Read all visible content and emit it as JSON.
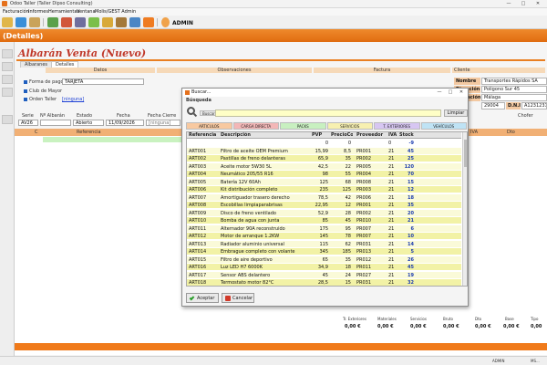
{
  "window": {
    "title": "Odoo Taller (Taller Dipso Consulting)",
    "controls": [
      "—",
      "□",
      "✕"
    ]
  },
  "menu": [
    "Facturación",
    "Informes",
    "Herramientas",
    "Ventana",
    "Molis/GEST Admin"
  ],
  "toolbar": {
    "user": "ADMIN"
  },
  "header": {
    "title": "(Detalles)"
  },
  "document": {
    "title": "Albarán Venta (Nuevo)",
    "tabs": [
      "Albaranes",
      "Detalles"
    ],
    "sections": [
      "Datos",
      "Observaciones",
      "Factura",
      "Cliente"
    ],
    "fields": {
      "forma_pago_label": "Forma de pago",
      "forma_pago_value": "TARJETA",
      "club_label": "Club de Mayor",
      "orden_label": "Orden Taller",
      "orden_link": "[ninguna]"
    },
    "cliente": {
      "nombre_label": "Nombre",
      "nombre_value": "Transportes Rápidos SA",
      "direccion_label": "Dirección",
      "direccion_value": "Polígono Sur 45",
      "poblacion_label": "Población",
      "poblacion_value": "Málaga",
      "cp_value": "29004",
      "dni_label": "D.N.I",
      "dni_value": "A12312312"
    },
    "header_row": {
      "labels": [
        "Serie",
        "Nº Albarán",
        "Estado",
        "Fecha",
        "Fecha Cierre",
        "Chofer"
      ],
      "serie": "AV26",
      "estado": "Abierto",
      "fecha": "11/09/2026",
      "fecha_cierre": "[ninguna]"
    },
    "lines_header": [
      "C",
      "Referencia",
      "IVA",
      "Dto"
    ],
    "totals": {
      "labels": [
        "Tr. Exteriores",
        "Materiales",
        "Servicios",
        "Bruto",
        "Dto",
        "Base",
        "Tipo"
      ],
      "values": [
        "0,00 €",
        "0,00 €",
        "0,00 €",
        "0,00 €",
        "0,00 €",
        "0,00 €",
        "0,00"
      ]
    }
  },
  "status": {
    "user": "ADMIN",
    "extra": "MS..."
  },
  "dialog": {
    "title": "Buscar...",
    "section": "Búsqueda",
    "search_label": "Buscar",
    "search_value": "",
    "clear_label": "Limpiar",
    "categories": [
      {
        "label": "ARTICULOS",
        "color": "#f8c9a0"
      },
      {
        "label": "CARGA DIRECTA",
        "color": "#f3b7b7"
      },
      {
        "label": "PACKS",
        "color": "#c8f0c0"
      },
      {
        "label": "SERVICIOS",
        "color": "#f7f0b0"
      },
      {
        "label": "T. EXTERIORES",
        "color": "#d7c6f2"
      },
      {
        "label": "VEHÍCULOS",
        "color": "#bfe3f5"
      }
    ],
    "columns": [
      "Referencia",
      "Descripción",
      "PVP",
      "PrecioCoste",
      "Proveedor",
      "IVA",
      "Stock"
    ],
    "rows": [
      {
        "ref": "",
        "desc": "",
        "pvp": "0",
        "coste": "0",
        "prov": "",
        "iva": "0",
        "stock": "-9"
      },
      {
        "ref": "ART001",
        "desc": "Filtro de aceite OEM Premium",
        "pvp": "15,99",
        "coste": "8,5",
        "prov": "PR001",
        "iva": "21",
        "stock": "45"
      },
      {
        "ref": "ART002",
        "desc": "Pastillas de freno delanteras",
        "pvp": "65,9",
        "coste": "35",
        "prov": "PR002",
        "iva": "21",
        "stock": "25"
      },
      {
        "ref": "ART003",
        "desc": "Aceite motor 5W30 5L",
        "pvp": "42,5",
        "coste": "22",
        "prov": "PR005",
        "iva": "21",
        "stock": "120"
      },
      {
        "ref": "ART004",
        "desc": "Neumático 205/55 R16",
        "pvp": "98",
        "coste": "55",
        "prov": "PR004",
        "iva": "21",
        "stock": "70"
      },
      {
        "ref": "ART005",
        "desc": "Batería 12V 60Ah",
        "pvp": "125",
        "coste": "68",
        "prov": "PR008",
        "iva": "21",
        "stock": "15"
      },
      {
        "ref": "ART006",
        "desc": "Kit distribución completo",
        "pvp": "235",
        "coste": "125",
        "prov": "PR003",
        "iva": "21",
        "stock": "12"
      },
      {
        "ref": "ART007",
        "desc": "Amortiguador trasero derecho",
        "pvp": "78,5",
        "coste": "42",
        "prov": "PR006",
        "iva": "21",
        "stock": "18"
      },
      {
        "ref": "ART008",
        "desc": "Escobillas limpiaparabrisas",
        "pvp": "22,95",
        "coste": "12",
        "prov": "PR001",
        "iva": "21",
        "stock": "35"
      },
      {
        "ref": "ART009",
        "desc": "Disco de freno ventilado",
        "pvp": "52,9",
        "coste": "28",
        "prov": "PR002",
        "iva": "21",
        "stock": "20"
      },
      {
        "ref": "ART010",
        "desc": "Bomba de agua con junta",
        "pvp": "85",
        "coste": "45",
        "prov": "PR010",
        "iva": "21",
        "stock": "21"
      },
      {
        "ref": "ART011",
        "desc": "Alternador 90A reconstruido",
        "pvp": "175",
        "coste": "95",
        "prov": "PR007",
        "iva": "21",
        "stock": "6"
      },
      {
        "ref": "ART012",
        "desc": "Motor de arranque 1.2KW",
        "pvp": "145",
        "coste": "78",
        "prov": "PR007",
        "iva": "21",
        "stock": "10"
      },
      {
        "ref": "ART013",
        "desc": "Radiador aluminio universal",
        "pvp": "115",
        "coste": "62",
        "prov": "PR031",
        "iva": "21",
        "stock": "14"
      },
      {
        "ref": "ART014",
        "desc": "Embrague completo con volante",
        "pvp": "345",
        "coste": "185",
        "prov": "PR013",
        "iva": "21",
        "stock": "5"
      },
      {
        "ref": "ART015",
        "desc": "Filtro de aire deportivo",
        "pvp": "65",
        "coste": "35",
        "prov": "PR012",
        "iva": "21",
        "stock": "26"
      },
      {
        "ref": "ART016",
        "desc": "Luz LED H7 6000K",
        "pvp": "34,9",
        "coste": "18",
        "prov": "PR011",
        "iva": "21",
        "stock": "45"
      },
      {
        "ref": "ART017",
        "desc": "Sensor ABS delantero",
        "pvp": "45",
        "coste": "24",
        "prov": "PR027",
        "iva": "21",
        "stock": "19"
      },
      {
        "ref": "ART018",
        "desc": "Termostato motor 82°C",
        "pvp": "28,5",
        "coste": "15",
        "prov": "PR031",
        "iva": "21",
        "stock": "32"
      }
    ],
    "ok_label": "Aceptar",
    "cancel_label": "Cancelar"
  }
}
